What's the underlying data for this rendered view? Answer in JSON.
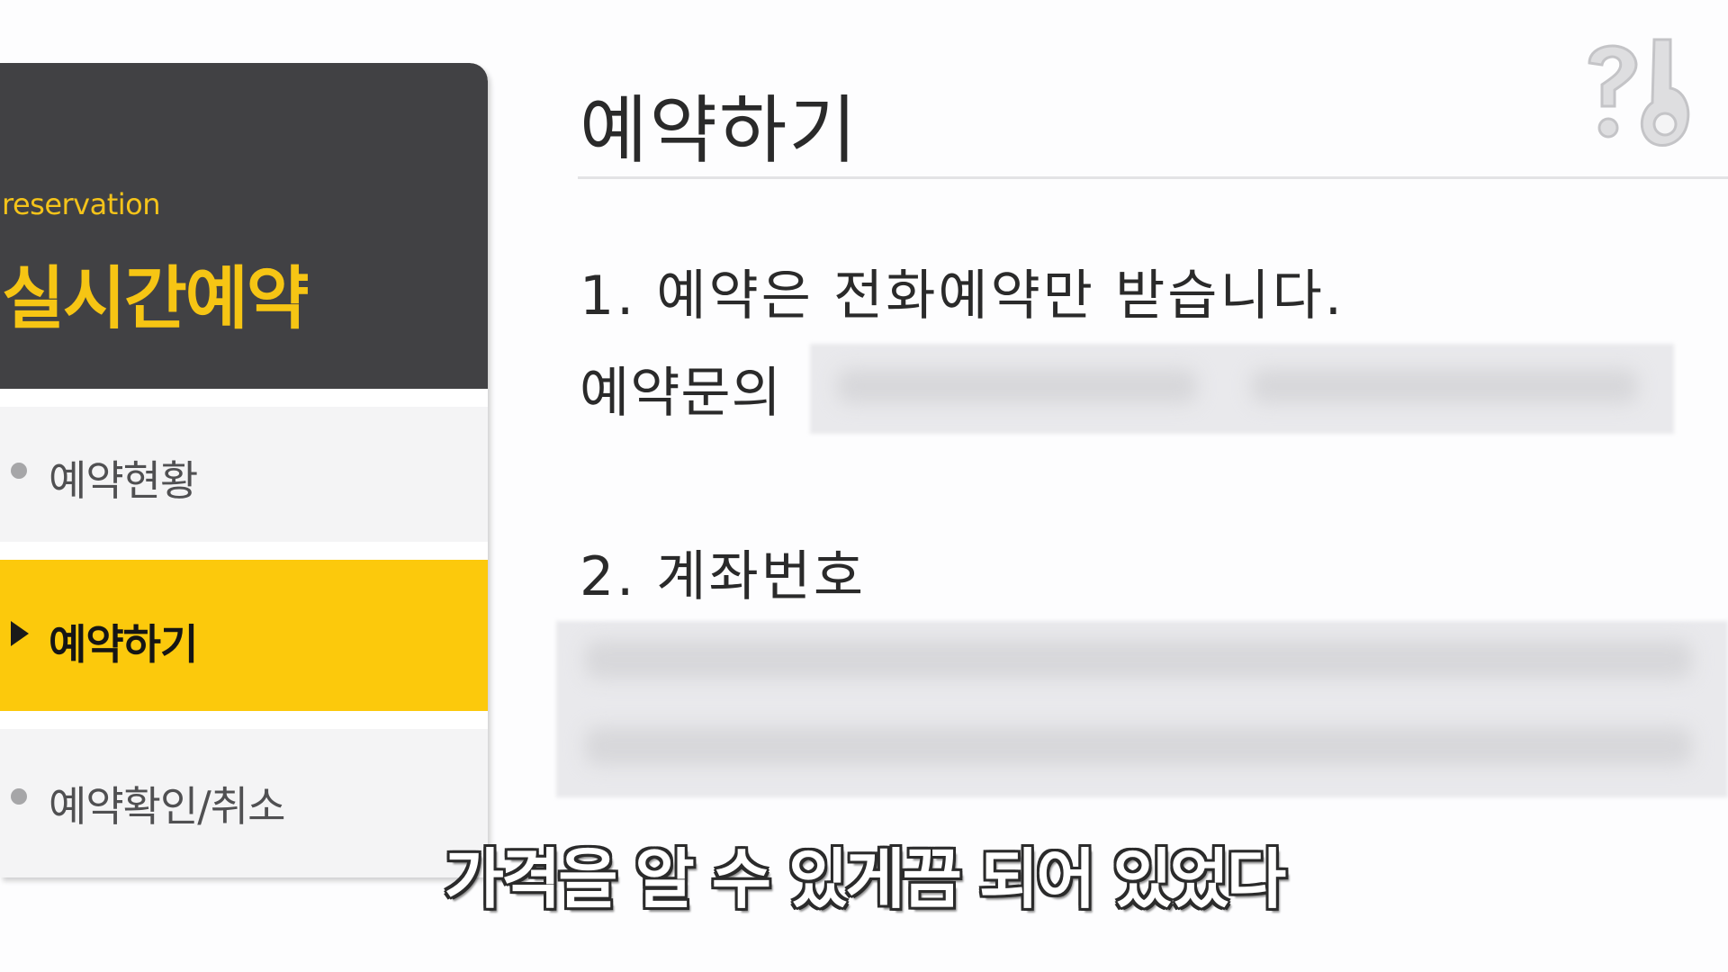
{
  "sidebar": {
    "subtitle": "reservation",
    "title": "실시간예약",
    "items": [
      {
        "label": "예약현황",
        "active": false
      },
      {
        "label": "예약하기",
        "active": true
      },
      {
        "label": "예약확인/취소",
        "active": false
      }
    ]
  },
  "main": {
    "title": "예약하기",
    "line1": "1. 예약은 전화예약만 받습니다.",
    "inquiry_label": "예약문의",
    "section2_title": "2. 계좌번호"
  },
  "caption": {
    "text": "가격을 알 수 있게끔 되어 있었다"
  },
  "colors": {
    "sidebar_header": "#414144",
    "accent_yellow": "#fcc90c",
    "header_text": "#f6c514"
  },
  "icons": {
    "logo": "channel-logo-icon",
    "bullet": "bullet-dot-icon",
    "arrow": "triangle-right-icon"
  }
}
